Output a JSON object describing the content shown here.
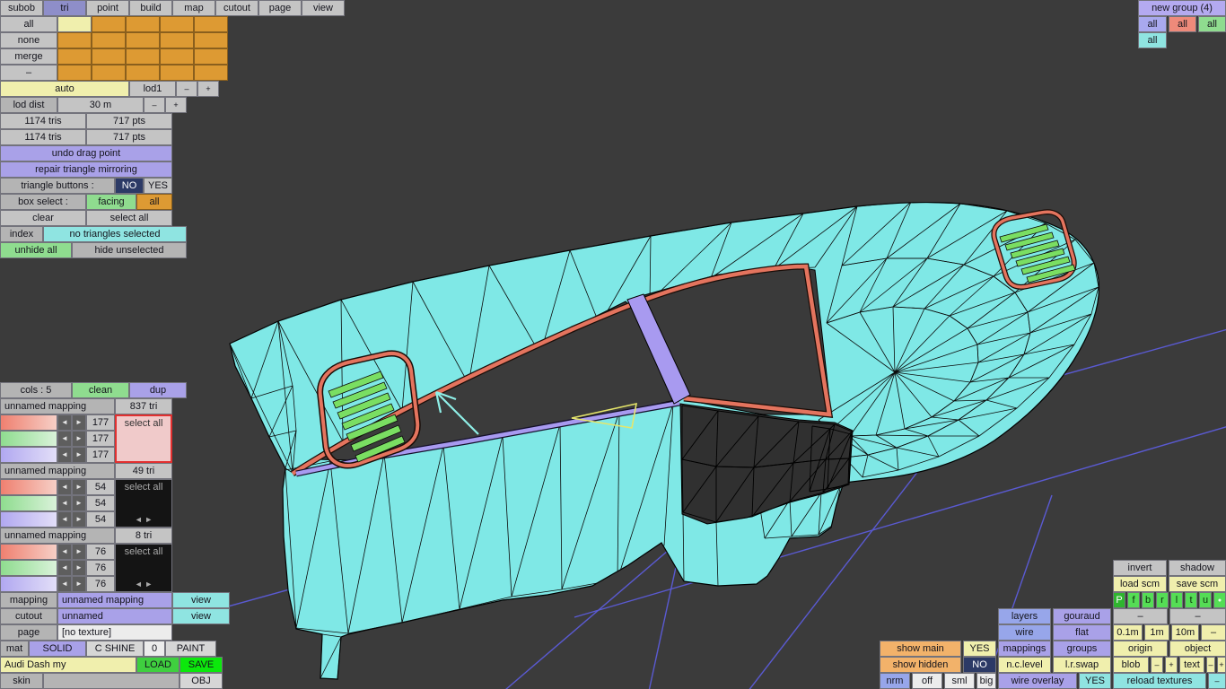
{
  "colors": {
    "viewport_bg": "#3b3b3b",
    "grid_line": "#5a5ad2",
    "model_fill": "#7fe8e6",
    "trim_salmon": "#e4745e",
    "trim_purple": "#a89af0",
    "vent_green": "#7ade62",
    "highlight_yellow": "#e6e66a",
    "cursor_cyan": "#8ff0e8"
  },
  "top_menu": {
    "items": [
      "subob",
      "tri",
      "point",
      "build",
      "map",
      "cutout",
      "page",
      "view"
    ],
    "active": "tri"
  },
  "subob": {
    "buttons": [
      "all",
      "none",
      "merge",
      "–"
    ]
  },
  "lod": {
    "auto": "auto",
    "lod1": "lod1",
    "minus": "–",
    "plus": "+",
    "dist_label": "lod dist",
    "dist_value": "30 m",
    "tris1": "1174 tris",
    "pts1": "717 pts",
    "tris2": "1174 tris",
    "pts2": "717 pts"
  },
  "tools": {
    "undo": "undo drag point",
    "repair": "repair triangle mirroring",
    "tri_buttons_label": "triangle buttons :",
    "no": "NO",
    "yes": "YES",
    "box_select_label": "box select :",
    "facing": "facing",
    "all": "all",
    "clear": "clear",
    "select_all": "select all",
    "index": "index",
    "selection_status": "no triangles selected",
    "unhide_all": "unhide all",
    "hide_unselected": "hide unselected"
  },
  "mappings_panel": {
    "cols": "cols : 5",
    "clean": "clean",
    "dup": "dup",
    "left_arrow": "◄",
    "right_arrow": "►",
    "groups": [
      {
        "name": "unnamed mapping",
        "count": "837 tri",
        "values": [
          "177",
          "177",
          "177"
        ],
        "select_all": "select all"
      },
      {
        "name": "unnamed mapping",
        "count": "49 tri",
        "values": [
          "54",
          "54",
          "54"
        ],
        "select_all": "select all"
      },
      {
        "name": "unnamed mapping",
        "count": "8 tri",
        "values": [
          "76",
          "76",
          "76"
        ],
        "select_all": "select all"
      }
    ]
  },
  "object_panel": {
    "mapping_label": "mapping",
    "mapping_value": "unnamed mapping",
    "mapping_view": "view",
    "cutout_label": "cutout",
    "cutout_value": "unnamed",
    "cutout_view": "view",
    "page_label": "page",
    "page_value": "[no texture]",
    "mat_label": "mat",
    "mat_solid": "SOLID",
    "mat_cshine": "C SHINE",
    "mat_zero": "0",
    "mat_paint": "PAINT",
    "file_name": "Audi Dash my",
    "load": "LOAD",
    "save": "SAVE",
    "skin_label": "skin",
    "obj": "OBJ"
  },
  "groups_panel": {
    "new_group": "new group (4)",
    "all1": "all",
    "all2": "all",
    "all3": "all",
    "all4": "all"
  },
  "view_panel": {
    "invert": "invert",
    "shadow": "shadow",
    "load_scm": "load scm",
    "save_scm": "save scm",
    "letters": [
      "P",
      "f",
      "b",
      "r",
      "l",
      "t",
      "u"
    ],
    "dot": "●",
    "layers": "layers",
    "gouraud": "gouraud",
    "dash": "–",
    "plus": "+",
    "wire": "wire",
    "flat": "flat",
    "m01": "0.1m",
    "m1": "1m",
    "m10": "10m",
    "show_main": "show main",
    "show_main_val": "YES",
    "mappings": "mappings",
    "groups": "groups",
    "origin": "origin",
    "object": "object",
    "show_hidden": "show hidden",
    "show_hidden_val": "NO",
    "nclevel": "n.c.level",
    "lrswap": "l.r.swap",
    "blob": "blob",
    "text": "text",
    "nrm": "nrm",
    "off": "off",
    "sml": "sml",
    "big": "big",
    "wire_overlay": "wire overlay",
    "wire_overlay_val": "YES",
    "reload_textures": "reload textures"
  }
}
